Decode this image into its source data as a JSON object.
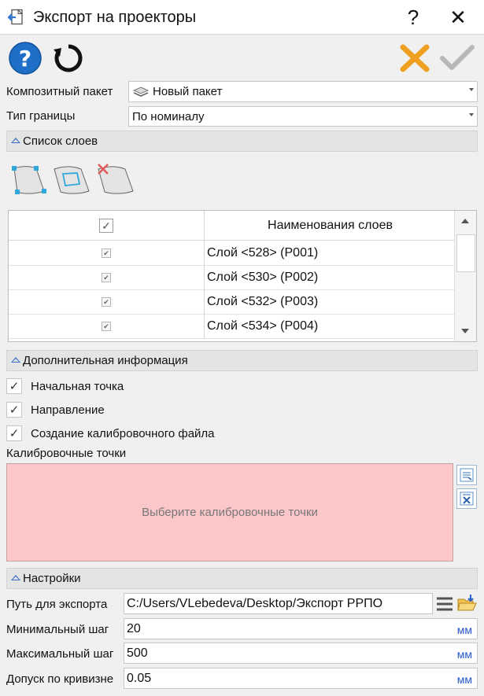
{
  "window": {
    "title": "Экспорт на проекторы",
    "help_glyph": "?",
    "close_glyph": "✕"
  },
  "toolbar": {
    "help_icon": "help-circle-icon",
    "refresh_icon": "refresh-icon",
    "cancel_icon": "cancel-icon",
    "ok_icon": "checkmark-icon",
    "help_mark": "?"
  },
  "composite_package": {
    "label": "Композитный пакет",
    "value": "Новый пакет"
  },
  "boundary_type": {
    "label": "Тип границы",
    "value": "По номиналу"
  },
  "layers_section": {
    "title": "Список слоев",
    "column_header": "Наименования слоев",
    "header_check": "✓",
    "rows": [
      {
        "name": "Слой <528> (P001)",
        "checked": "✔"
      },
      {
        "name": "Слой <530> (P002)",
        "checked": "✔"
      },
      {
        "name": "Слой <532> (P003)",
        "checked": "✔"
      },
      {
        "name": "Слой <534> (P004)",
        "checked": "✔"
      }
    ]
  },
  "extra_section": {
    "title": "Дополнительная информация",
    "options": [
      {
        "label": "Начальная точка",
        "mark": "✓"
      },
      {
        "label": "Направление",
        "mark": "✓"
      },
      {
        "label": "Создание калибровочного файла",
        "mark": "✓"
      }
    ],
    "calibration_label": "Калибровочные точки",
    "calibration_placeholder": "Выберите калибровочные точки"
  },
  "settings_section": {
    "title": "Настройки",
    "export_path_label": "Путь для экспорта",
    "export_path_value": "C:/Users/VLebedeva/Desktop/Экспорт PPПО",
    "min_step_label": "Минимальный шаг",
    "min_step_value": "20",
    "max_step_label": "Максимальный шаг",
    "max_step_value": "500",
    "curvature_label": "Допуск по кривизне",
    "curvature_value": "0.05",
    "unit": "мм"
  },
  "colors": {
    "accent": "#3a6fc4",
    "cancel": "#f0a020",
    "ok": "#b8b8b8",
    "calibration_bg": "#fcc7c8",
    "unit": "#2456d0"
  }
}
